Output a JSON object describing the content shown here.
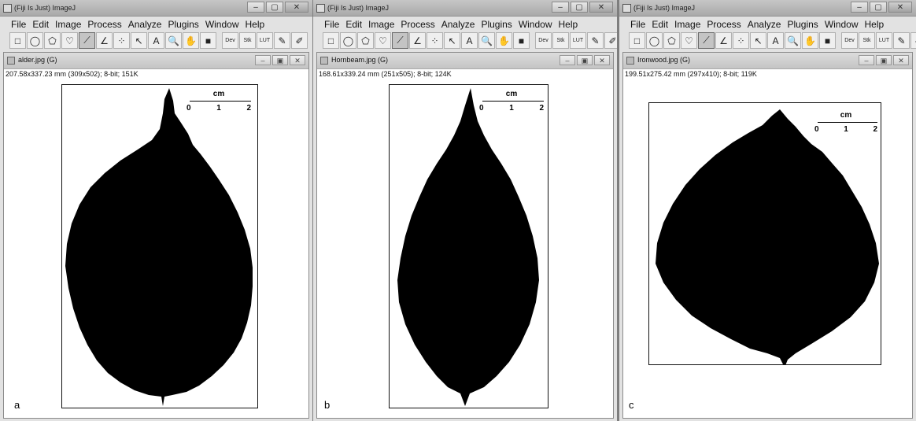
{
  "app": {
    "window_title": "(Fiji Is Just) ImageJ",
    "menu": [
      "File",
      "Edit",
      "Image",
      "Process",
      "Analyze",
      "Plugins",
      "Window",
      "Help"
    ],
    "window_buttons": [
      "–",
      "▢",
      "✕"
    ],
    "image_window_buttons": [
      "–",
      "▣",
      "✕"
    ]
  },
  "tools": [
    {
      "name": "rectangle-tool-icon",
      "glyph": "□"
    },
    {
      "name": "oval-tool-icon",
      "glyph": "◯"
    },
    {
      "name": "polygon-tool-icon",
      "glyph": "⬠"
    },
    {
      "name": "freehand-tool-icon",
      "glyph": "♡"
    },
    {
      "name": "line-tool-icon",
      "glyph": "⟋",
      "selected": true
    },
    {
      "name": "angle-tool-icon",
      "glyph": "∠"
    },
    {
      "name": "multipoint-tool-icon",
      "glyph": "⁘"
    },
    {
      "name": "wand-tool-icon",
      "glyph": "↖"
    },
    {
      "name": "text-tool-icon",
      "glyph": "A"
    },
    {
      "name": "zoom-tool-icon",
      "glyph": "🔍"
    },
    {
      "name": "hand-tool-icon",
      "glyph": "✋"
    },
    {
      "name": "color-picker-icon",
      "glyph": "■"
    },
    {
      "name": "dev-menu-icon",
      "glyph": "Dev",
      "gap": true,
      "small": true
    },
    {
      "name": "stk-menu-icon",
      "glyph": "Stk",
      "small": true
    },
    {
      "name": "lut-menu-icon",
      "glyph": "LUT",
      "small": true
    },
    {
      "name": "pencil-tool-icon",
      "glyph": "✎"
    },
    {
      "name": "brush-tool-icon",
      "glyph": "✐"
    }
  ],
  "panels": [
    {
      "label": "a",
      "image_title": "alder.jpg (G)",
      "info": "207.58x337.23 mm (309x502); 8-bit; 151K",
      "scale": {
        "unit": "cm",
        "ticks": [
          "0",
          "1",
          "2"
        ]
      }
    },
    {
      "label": "b",
      "image_title": "Hornbeam.jpg (G)",
      "info": "168.61x339.24 mm (251x505); 8-bit; 124K",
      "scale": {
        "unit": "cm",
        "ticks": [
          "0",
          "1",
          "2"
        ]
      }
    },
    {
      "label": "c",
      "image_title": "Ironwood.jpg (G)",
      "info": "199.51x275.42 mm (297x410); 8-bit; 119K",
      "scale": {
        "unit": "cm",
        "ticks": [
          "0",
          "1",
          "2"
        ]
      }
    }
  ]
}
